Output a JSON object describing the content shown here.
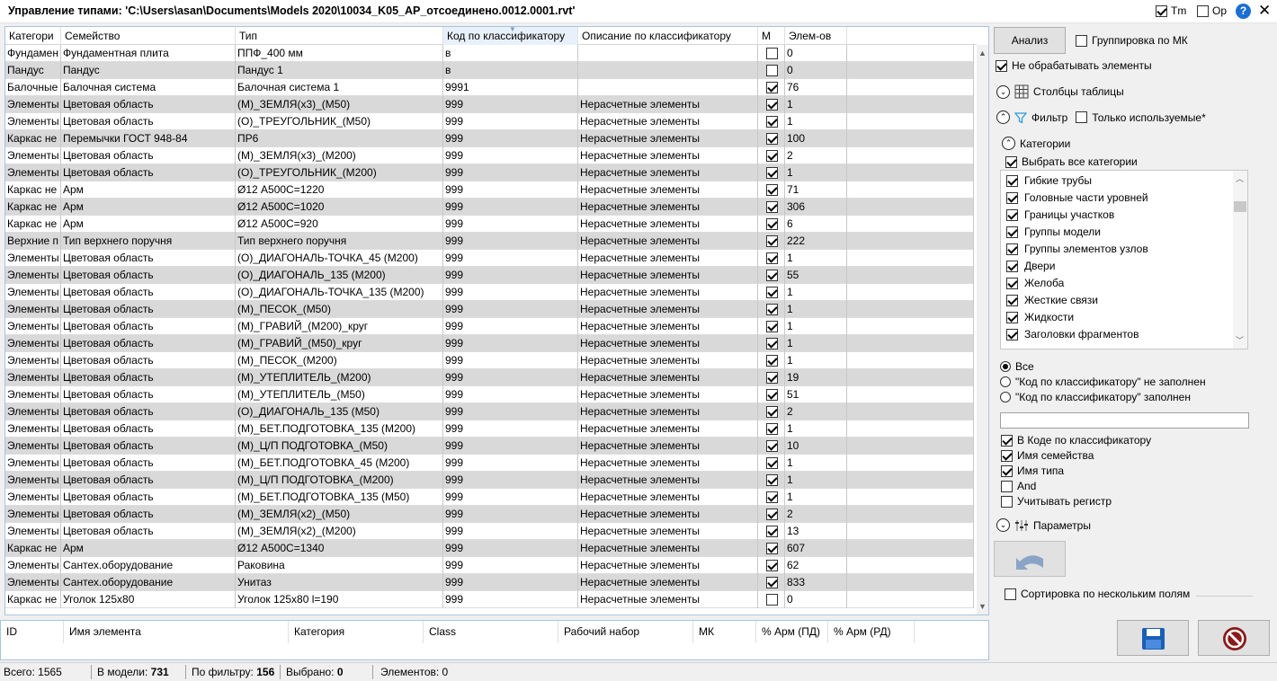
{
  "window": {
    "title": "Управление типами: 'C:\\Users\\asan\\Documents\\Models 2020\\10034_K05_AP_отсоединено.0012.0001.rvt'",
    "tm_label": "Tm",
    "tm_checked": true,
    "op_label": "Op",
    "op_checked": false,
    "help_label": "?"
  },
  "grid": {
    "columns": [
      "Категори",
      "Семейство",
      "Тип",
      "Код по классификатору",
      "Описание по классификатору",
      "М",
      "Элем-ов"
    ],
    "rows": [
      [
        "Фундамен",
        "Фундаментная плита",
        "ППФ_400 мм",
        "в",
        "",
        false,
        "0"
      ],
      [
        "Пандус",
        "Пандус",
        "Пандус 1",
        "в",
        "",
        false,
        "0"
      ],
      [
        "Балочные",
        "Балочная система",
        "Балочная система 1",
        "9991",
        "",
        true,
        "76"
      ],
      [
        "Элементы",
        "Цветовая область",
        "(М)_ЗЕМЛЯ(х3)_(М50)",
        "999",
        "Нерасчетные элементы",
        true,
        "1"
      ],
      [
        "Элементы",
        "Цветовая область",
        "(О)_ТРЕУГОЛЬНИК_(М50)",
        "999",
        "Нерасчетные элементы",
        true,
        "1"
      ],
      [
        "Каркас не",
        "Перемычки ГОСТ 948-84",
        "ПР6",
        "999",
        "Нерасчетные элементы",
        true,
        "100"
      ],
      [
        "Элементы",
        "Цветовая область",
        "(М)_ЗЕМЛЯ(х3)_(М200)",
        "999",
        "Нерасчетные элементы",
        true,
        "2"
      ],
      [
        "Элементы",
        "Цветовая область",
        "(О)_ТРЕУГОЛЬНИК_(М200)",
        "999",
        "Нерасчетные элементы",
        true,
        "1"
      ],
      [
        "Каркас не",
        "Арм",
        "Ø12 А500С=1220",
        "999",
        "Нерасчетные элементы",
        true,
        "71"
      ],
      [
        "Каркас не",
        "Арм",
        "Ø12 А500С=1020",
        "999",
        "Нерасчетные элементы",
        true,
        "306"
      ],
      [
        "Каркас не",
        "Арм",
        "Ø12 А500С=920",
        "999",
        "Нерасчетные элементы",
        true,
        "6"
      ],
      [
        "Верхние п",
        "Тип верхнего поручня",
        "Тип верхнего поручня",
        "999",
        "Нерасчетные элементы",
        true,
        "222"
      ],
      [
        "Элементы",
        "Цветовая область",
        "(О)_ДИАГОНАЛЬ-ТОЧКА_45 (М200)",
        "999",
        "Нерасчетные элементы",
        true,
        "1"
      ],
      [
        "Элементы",
        "Цветовая область",
        "(О)_ДИАГОНАЛЬ_135 (М200)",
        "999",
        "Нерасчетные элементы",
        true,
        "55"
      ],
      [
        "Элементы",
        "Цветовая область",
        "(О)_ДИАГОНАЛЬ-ТОЧКА_135 (М200)",
        "999",
        "Нерасчетные элементы",
        true,
        "1"
      ],
      [
        "Элементы",
        "Цветовая область",
        "(М)_ПЕСОК_(М50)",
        "999",
        "Нерасчетные элементы",
        true,
        "1"
      ],
      [
        "Элементы",
        "Цветовая область",
        "(М)_ГРАВИЙ_(М200)_круг",
        "999",
        "Нерасчетные элементы",
        true,
        "1"
      ],
      [
        "Элементы",
        "Цветовая область",
        "(М)_ГРАВИЙ_(М50)_круг",
        "999",
        "Нерасчетные элементы",
        true,
        "1"
      ],
      [
        "Элементы",
        "Цветовая область",
        "(М)_ПЕСОК_(М200)",
        "999",
        "Нерасчетные элементы",
        true,
        "1"
      ],
      [
        "Элементы",
        "Цветовая область",
        "(М)_УТЕПЛИТЕЛЬ_(М200)",
        "999",
        "Нерасчетные элементы",
        true,
        "19"
      ],
      [
        "Элементы",
        "Цветовая область",
        "(М)_УТЕПЛИТЕЛЬ_(М50)",
        "999",
        "Нерасчетные элементы",
        true,
        "51"
      ],
      [
        "Элементы",
        "Цветовая область",
        "(О)_ДИАГОНАЛЬ_135 (М50)",
        "999",
        "Нерасчетные элементы",
        true,
        "2"
      ],
      [
        "Элементы",
        "Цветовая область",
        "(М)_БЕТ.ПОДГОТОВКА_135 (М200)",
        "999",
        "Нерасчетные элементы",
        true,
        "1"
      ],
      [
        "Элементы",
        "Цветовая область",
        "(М)_Ц/П ПОДГОТОВКА_(М50)",
        "999",
        "Нерасчетные элементы",
        true,
        "10"
      ],
      [
        "Элементы",
        "Цветовая область",
        "(М)_БЕТ.ПОДГОТОВКА_45 (М200)",
        "999",
        "Нерасчетные элементы",
        true,
        "1"
      ],
      [
        "Элементы",
        "Цветовая область",
        "(М)_Ц/П ПОДГОТОВКА_(М200)",
        "999",
        "Нерасчетные элементы",
        true,
        "1"
      ],
      [
        "Элементы",
        "Цветовая область",
        "(М)_БЕТ.ПОДГОТОВКА_135 (М50)",
        "999",
        "Нерасчетные элементы",
        true,
        "1"
      ],
      [
        "Элементы",
        "Цветовая область",
        "(М)_ЗЕМЛЯ(х2)_(М50)",
        "999",
        "Нерасчетные элементы",
        true,
        "2"
      ],
      [
        "Элементы",
        "Цветовая область",
        "(М)_ЗЕМЛЯ(х2)_(М200)",
        "999",
        "Нерасчетные элементы",
        true,
        "13"
      ],
      [
        "Каркас не",
        "Арм",
        "Ø12 А500С=1340",
        "999",
        "Нерасчетные элементы",
        true,
        "607"
      ],
      [
        "Элементы",
        "Сантех.оборудование",
        "Раковина",
        "999",
        "Нерасчетные элементы",
        true,
        "62"
      ],
      [
        "Элементы",
        "Сантех.оборудование",
        "Унитаз",
        "999",
        "Нерасчетные элементы",
        true,
        "833"
      ],
      [
        "Каркас не",
        "Уголок 125х80",
        "Уголок 125х80 l=190",
        "999",
        "Нерасчетные элементы",
        false,
        "0"
      ]
    ]
  },
  "detail": {
    "columns": [
      "ID",
      "Имя элемента",
      "Категория",
      "Class",
      "Рабочий набор",
      "МК",
      "% Арм (ПД)",
      "% Арм (РД)"
    ]
  },
  "status": {
    "total_label": "Всего:",
    "total_value": "1565",
    "model_label": "В модели:",
    "model_value": "731",
    "filter_label": "По фильтру:",
    "filter_value": "156",
    "selected_label": "Выбрано:",
    "selected_value": "0",
    "elements_label": "Элементов:",
    "elements_value": "0"
  },
  "panel": {
    "analyze_label": "Анализ",
    "group_mk_label": "Группировка по МК",
    "group_mk_checked": false,
    "no_process_label": "Не обрабатывать элементы",
    "no_process_checked": true,
    "columns_label": "Столбцы таблицы",
    "filter_label": "Фильтр",
    "only_used_label": "Только используемые*",
    "only_used_checked": false,
    "categories_label": "Категории",
    "select_all_label": "Выбрать все категории",
    "select_all_checked": true,
    "categories": [
      "Гибкие трубы",
      "Головные части уровней",
      "Границы участков",
      "Группы модели",
      "Группы элементов узлов",
      "Двери",
      "Желоба",
      "Жесткие связи",
      "Жидкости",
      "Заголовки фрагментов"
    ],
    "radio_options": [
      "Все",
      "\"Код по классификатору\" не заполнен",
      "\"Код по классификатору\" заполнен"
    ],
    "radio_selected": 0,
    "search_value": "",
    "search_options": [
      {
        "label": "В Коде по классификатору",
        "checked": true
      },
      {
        "label": "Имя семейства",
        "checked": true
      },
      {
        "label": "Имя типа",
        "checked": true
      },
      {
        "label": "And",
        "checked": false
      },
      {
        "label": "Учитывать регистр",
        "checked": false
      }
    ],
    "parameters_label": "Параметры",
    "multi_sort_label": "Сортировка по нескольким полям",
    "multi_sort_checked": false,
    "icons": {
      "undo": "undo-arrow-icon",
      "save": "floppy-disk-icon",
      "cancel": "no-entry-icon"
    },
    "colors": {
      "filter_icon": "#2f9ad8",
      "save_icon": "#1a5fb4",
      "cancel_icon": "#8b1a1a"
    }
  }
}
